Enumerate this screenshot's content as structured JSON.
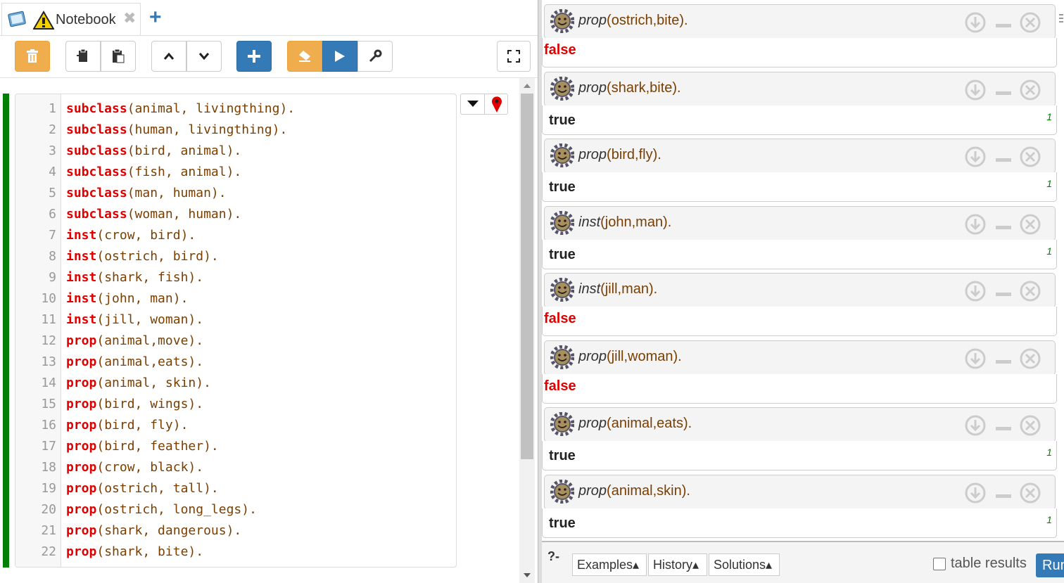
{
  "tab": {
    "title": "Notebook",
    "close": "✖",
    "add": "+"
  },
  "colors": {
    "orange": "#f0ad4e",
    "blue": "#337ab7",
    "green_bar": "#008000",
    "keyword": "#e00000",
    "atom": "#7a3e00"
  },
  "toolbar": {
    "icons": [
      "trash-icon",
      "copy-icon",
      "paste-icon",
      "move-up-icon",
      "move-down-icon",
      "insert-cell-icon",
      "clear-icon",
      "run-icon",
      "settings-icon",
      "fullscreen-icon"
    ]
  },
  "editor": {
    "lines": [
      {
        "n": "1",
        "kw": "subclass",
        "rest": "(animal, livingthing)."
      },
      {
        "n": "2",
        "kw": "subclass",
        "rest": "(human, livingthing)."
      },
      {
        "n": "3",
        "kw": "subclass",
        "rest": "(bird, animal)."
      },
      {
        "n": "4",
        "kw": "subclass",
        "rest": "(fish, animal)."
      },
      {
        "n": "5",
        "kw": "subclass",
        "rest": "(man, human)."
      },
      {
        "n": "6",
        "kw": "subclass",
        "rest": "(woman, human)."
      },
      {
        "n": "7",
        "kw": "inst",
        "rest": "(crow, bird)."
      },
      {
        "n": "8",
        "kw": "inst",
        "rest": "(ostrich, bird)."
      },
      {
        "n": "9",
        "kw": "inst",
        "rest": "(shark, fish)."
      },
      {
        "n": "10",
        "kw": "inst",
        "rest": "(john, man)."
      },
      {
        "n": "11",
        "kw": "inst",
        "rest": "(jill, woman)."
      },
      {
        "n": "12",
        "kw": "prop",
        "rest": "(animal,move)."
      },
      {
        "n": "13",
        "kw": "prop",
        "rest": "(animal,eats)."
      },
      {
        "n": "14",
        "kw": "prop",
        "rest": "(animal, skin)."
      },
      {
        "n": "15",
        "kw": "prop",
        "rest": "(bird, wings)."
      },
      {
        "n": "16",
        "kw": "prop",
        "rest": "(bird, fly)."
      },
      {
        "n": "17",
        "kw": "prop",
        "rest": "(bird, feather)."
      },
      {
        "n": "18",
        "kw": "prop",
        "rest": "(crow, black)."
      },
      {
        "n": "19",
        "kw": "prop",
        "rest": "(ostrich, tall)."
      },
      {
        "n": "20",
        "kw": "prop",
        "rest": "(ostrich, long_legs)."
      },
      {
        "n": "21",
        "kw": "prop",
        "rest": "(shark, dangerous)."
      },
      {
        "n": "22",
        "kw": "prop",
        "rest": "(shark, bite)."
      }
    ]
  },
  "answers": [
    {
      "fn": "prop",
      "args": "(ostrich,bite).",
      "result": "false",
      "count": ""
    },
    {
      "fn": "prop",
      "args": "(shark,bite).",
      "result": "true",
      "count": "1"
    },
    {
      "fn": "prop",
      "args": "(bird,fly).",
      "result": "true",
      "count": "1"
    },
    {
      "fn": "inst",
      "args": "(john,man).",
      "result": "true",
      "count": "1"
    },
    {
      "fn": "inst",
      "args": "(jill,man).",
      "result": "false",
      "count": ""
    },
    {
      "fn": "prop",
      "args": "(jill,woman).",
      "result": "false",
      "count": ""
    },
    {
      "fn": "prop",
      "args": "(animal,eats).",
      "result": "true",
      "count": "1"
    },
    {
      "fn": "prop",
      "args": "(animal,skin).",
      "result": "true",
      "count": "1"
    }
  ],
  "query": {
    "prompt": "?-",
    "examples": "Examples▴",
    "history": "History▴",
    "solutions": "Solutions▴",
    "table_results": "table results",
    "run": "Run"
  }
}
